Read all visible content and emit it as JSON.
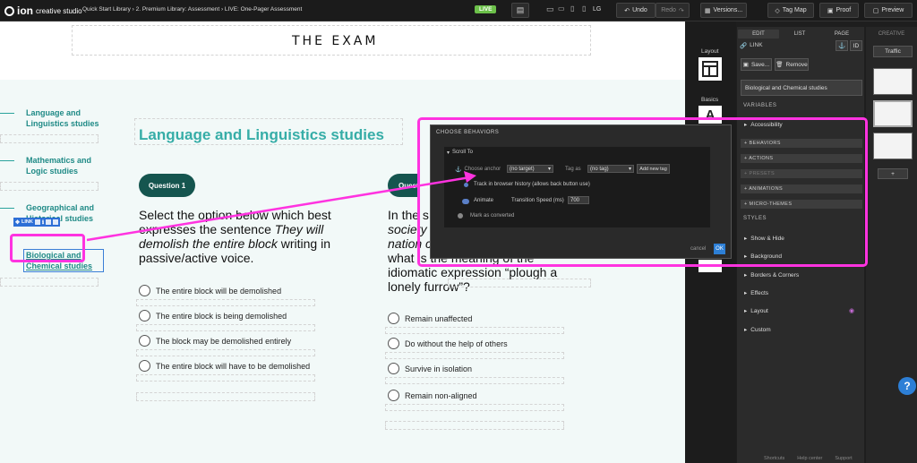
{
  "topbar": {
    "logo_text": "ion",
    "logo_sub": "creative studio",
    "breadcrumbs": "Quick Start Library  ›  2. Premium Library: Assessment  ›  LIVE: One-Pager Assessment",
    "live_badge": "LIVE",
    "device_lg": "LG",
    "undo": "Undo",
    "redo": "Redo",
    "versions": "Versions...",
    "tag_map": "Tag Map",
    "proof": "Proof",
    "preview": "Preview"
  },
  "canvas": {
    "brand": "THE EXAM",
    "nav": [
      {
        "line1": "Language and",
        "line2": "Linguistics studies"
      },
      {
        "line1": "Mathematics and",
        "line2": "Logic studies"
      },
      {
        "line1": "Geographical and",
        "line2": "Historical studies"
      },
      {
        "line1": "Biological and",
        "line2": "Chemical studies"
      }
    ],
    "link_tool_label": "LINK",
    "heading": "Language and Linguistics studies",
    "q1": {
      "badge": "Question 1",
      "text_a": "Select the option below which best expresses the sentence ",
      "text_em": "They will demolish the entire block",
      "text_b": " writing in passive/active voice.",
      "options": [
        "The entire block will be demolished",
        "The entire block is being demolished",
        "The block may be demolished entirely",
        "The entire block will have to be demolished"
      ]
    },
    "q2": {
      "badge": "Question",
      "line1": "In the s",
      "line2": "society",
      "line3": "nation c",
      "line4": "what is the meaning of the",
      "line5": "idiomatic expression “plough a",
      "line6": "lonely furrow”?",
      "options": [
        "Remain unaffected",
        "Do without the help of others",
        "Survive in isolation",
        "Remain non-aligned"
      ]
    }
  },
  "tools": {
    "layout": "Layout",
    "basics": "Basics"
  },
  "panel": {
    "tabs": [
      "EDIT",
      "LIST",
      "PAGE"
    ],
    "creative_tab": "CREATIVE",
    "link_label": "LINK",
    "id_button": "ID",
    "save": "Save...",
    "remove": "Remove",
    "name_field": "Biological and Chemical studies",
    "variables": "VARIABLES",
    "accessibility": "Accessibility",
    "rows": [
      "+ BEHAVIORS",
      "+ ACTIONS",
      "+ PRESETS",
      "+ ANIMATIONS",
      "+ MICRO-THEMES"
    ],
    "styles": "STYLES",
    "style_items": [
      "Show & Hide",
      "Background",
      "Borders & Corners",
      "Effects",
      "Layout",
      "Custom"
    ],
    "traffic": "Traffic",
    "add": "+"
  },
  "modal": {
    "title": "CHOOSE BEHAVIORS",
    "section": "Scroll To",
    "choose_anchor": "Choose anchor",
    "anchor_value": "(no target)",
    "tag_as": "Tag as",
    "tag_value": "(no tag)",
    "add_new_tag": "Add new tag",
    "track": "Track in browser history (allows back button use)",
    "animate": "Animate",
    "speed_label": "Transition Speed (ms)",
    "speed_value": "700",
    "mark": "Mark as converted",
    "cancel": "cancel",
    "ok": "OK"
  },
  "footer": {
    "shortcuts": "Shortcuts",
    "help": "Help center",
    "support": "Support"
  },
  "help_button": "?",
  "colors": {
    "accent_teal": "#36ada7",
    "badge_dark": "#15554f",
    "annotation_pink": "#ff33e0",
    "live_green": "#6cc04a"
  }
}
